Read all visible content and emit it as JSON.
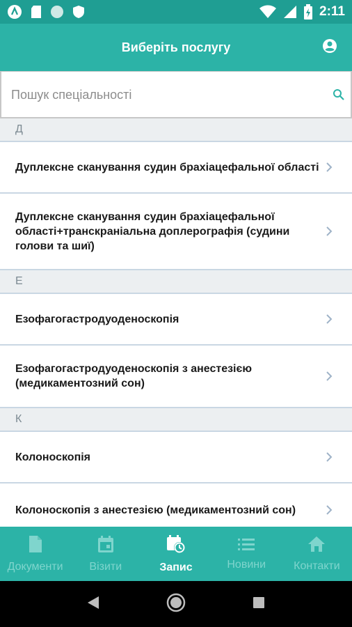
{
  "status_bar": {
    "time": "2:11",
    "icons": [
      "arrow-app-icon",
      "sd-card-icon",
      "circle-icon",
      "shield-icon",
      "wifi-icon",
      "signal-icon",
      "battery-icon"
    ]
  },
  "header": {
    "title": "Виберіть послугу",
    "profile_icon": "account-circle-icon"
  },
  "search": {
    "placeholder": "Пошук спеціальності",
    "value": "",
    "icon": "search-icon"
  },
  "sections": [
    {
      "letter": "Д",
      "items": [
        "Дуплексне сканування судин брахіацефальної області",
        "Дуплексне сканування судин брахіацефальної області+транскраніальна доплерографія (судини голови та шиї)"
      ]
    },
    {
      "letter": "Е",
      "items": [
        "Езофагогастродуоденоскопія",
        "Езофагогастродуоденоскопія з анестезією (медикаментозний сон)"
      ]
    },
    {
      "letter": "К",
      "items": [
        "Колоноскопія",
        "Колоноскопія з анестезією (медикаментозний сон)"
      ]
    }
  ],
  "bottom_nav": {
    "items": [
      {
        "label": "Документи",
        "icon": "document-icon",
        "active": false
      },
      {
        "label": "Візити",
        "icon": "calendar-icon",
        "active": false
      },
      {
        "label": "Запис",
        "icon": "calendar-clock-icon",
        "active": true
      },
      {
        "label": "Новини",
        "icon": "list-icon",
        "active": false
      },
      {
        "label": "Контакти",
        "icon": "home-icon",
        "active": false
      }
    ]
  },
  "colors": {
    "status_bar": "#1f9e93",
    "primary": "#2cb3a7",
    "section_bg": "#eceff1",
    "divider": "#c9d7e3",
    "nav_inactive": "#7fd5cd",
    "nav_active": "#ffffff"
  }
}
